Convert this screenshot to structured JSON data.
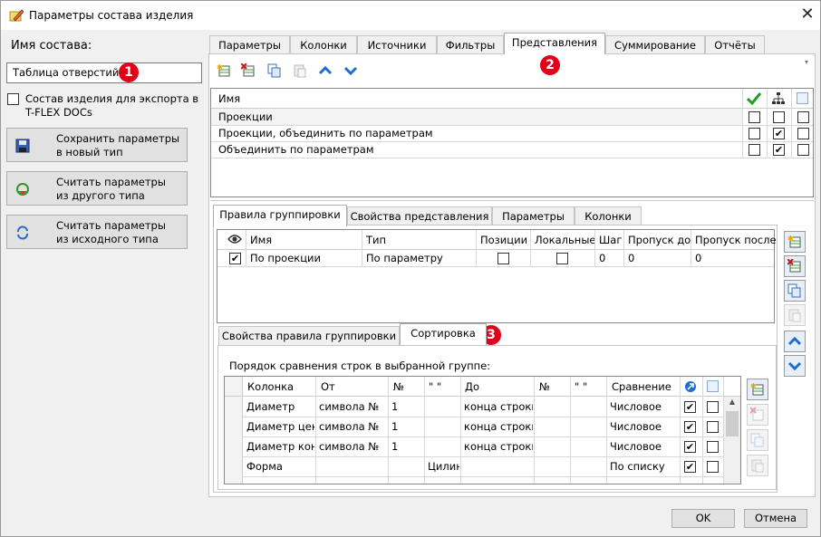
{
  "window": {
    "title": "Параметры состава изделия",
    "close_glyph": "✕"
  },
  "left": {
    "name_label": "Имя состава:",
    "name_value": "Таблица отверстий",
    "export_checkbox_label_1": "Состав изделия для экспорта в",
    "export_checkbox_label_2": "T-FLEX DOCs",
    "save_btn_1": "Сохранить параметры",
    "save_btn_2": "в новый тип",
    "read_other_1": "Считать параметры",
    "read_other_2": "из другого типа",
    "read_src_1": "Считать параметры",
    "read_src_2": "из исходного типа"
  },
  "badges": [
    "1",
    "2",
    "3"
  ],
  "main_tabs": [
    "Параметры",
    "Колонки",
    "Источники",
    "Фильтры",
    "Представления",
    "Суммирование",
    "Отчёты"
  ],
  "views_grid": {
    "header_name": "Имя",
    "rows": [
      {
        "name": "Проекции",
        "c1": false,
        "c2": false,
        "c3": false
      },
      {
        "name": "Проекции, объединить по параметрам",
        "c1": false,
        "c2": true,
        "c3": false
      },
      {
        "name": "Объединить по параметрам",
        "c1": false,
        "c2": true,
        "c3": false
      }
    ]
  },
  "sub_tabs": [
    "Правила группировки",
    "Свойства представления",
    "Параметры",
    "Колонки"
  ],
  "group_grid": {
    "headers": [
      "Имя",
      "Тип",
      "Позиции",
      "Локальные",
      "Шаг",
      "Пропуск до",
      "Пропуск после"
    ],
    "rows": [
      {
        "visible": true,
        "name": "По проекции",
        "type": "По параметру",
        "positions": false,
        "local": false,
        "step": "0",
        "skip_before": "0",
        "skip_after": "0"
      }
    ]
  },
  "rule_tabs": [
    "Свойства правила группировки",
    "Сортировка"
  ],
  "sort": {
    "caption": "Порядок сравнения строк в выбранной группе:",
    "headers": [
      "Колонка",
      "От",
      "№",
      "\" \"",
      "До",
      "№",
      "\" \"",
      "Сравнение"
    ],
    "rows": [
      {
        "col": "Диаметр",
        "from": "символа №",
        "n1": "1",
        "q1": "",
        "to": "конца строки",
        "n2": "",
        "q2": "",
        "cmp": "Числовое",
        "a": true,
        "b": false
      },
      {
        "col": "Диаметр цековки",
        "from": "символа №",
        "n1": "1",
        "q1": "",
        "to": "конца строки",
        "n2": "",
        "q2": "",
        "cmp": "Числовое",
        "a": true,
        "b": false
      },
      {
        "col": "Диаметр конуса",
        "from": "символа №",
        "n1": "1",
        "q1": "",
        "to": "конца строки",
        "n2": "",
        "q2": "",
        "cmp": "Числовое",
        "a": true,
        "b": false
      },
      {
        "col": "Форма",
        "from": "",
        "n1": "",
        "q1": "Цилиндр",
        "to": "",
        "n2": "",
        "q2": "",
        "cmp": "По списку",
        "a": true,
        "b": false
      }
    ]
  },
  "footer": {
    "ok": "OK",
    "cancel": "Отмена"
  },
  "colors": {
    "accent": "#1c6fd1",
    "badge": "#e0001a",
    "check_green": "#1fa31f"
  }
}
